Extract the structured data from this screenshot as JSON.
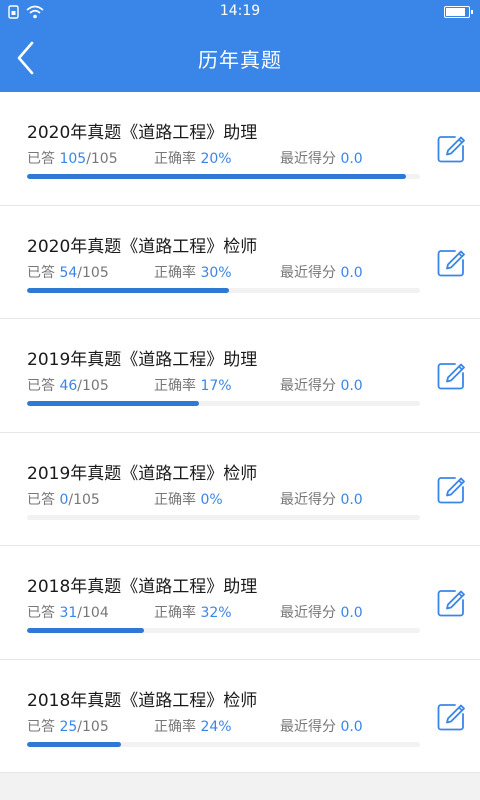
{
  "status_bar": {
    "time": "14:19",
    "icons": [
      "sim-icon",
      "wifi-icon",
      "battery-icon"
    ]
  },
  "nav": {
    "title": "历年真题",
    "back_icon": "chevron-left-icon"
  },
  "labels": {
    "answered": "已答",
    "accuracy": "正确率",
    "recent_score": "最近得分"
  },
  "colors": {
    "primary": "#3a86e8",
    "bar": "#2f78d6"
  },
  "items": [
    {
      "title": "2020年真题《道路工程》助理",
      "answered": "105",
      "total": "/105",
      "accuracy": "20%",
      "score": "0.0",
      "progress": 0.965
    },
    {
      "title": "2020年真题《道路工程》检师",
      "answered": "54",
      "total": "/105",
      "accuracy": "30%",
      "score": "0.0",
      "progress": 0.514
    },
    {
      "title": "2019年真题《道路工程》助理",
      "answered": "46",
      "total": "/105",
      "accuracy": "17%",
      "score": "0.0",
      "progress": 0.438
    },
    {
      "title": "2019年真题《道路工程》检师",
      "answered": "0",
      "total": "/105",
      "accuracy": "0%",
      "score": "0.0",
      "progress": 0
    },
    {
      "title": "2018年真题《道路工程》助理",
      "answered": "31",
      "total": "/104",
      "accuracy": "32%",
      "score": "0.0",
      "progress": 0.298
    },
    {
      "title": "2018年真题《道路工程》检师",
      "answered": "25",
      "total": "/105",
      "accuracy": "24%",
      "score": "0.0",
      "progress": 0.238
    }
  ]
}
